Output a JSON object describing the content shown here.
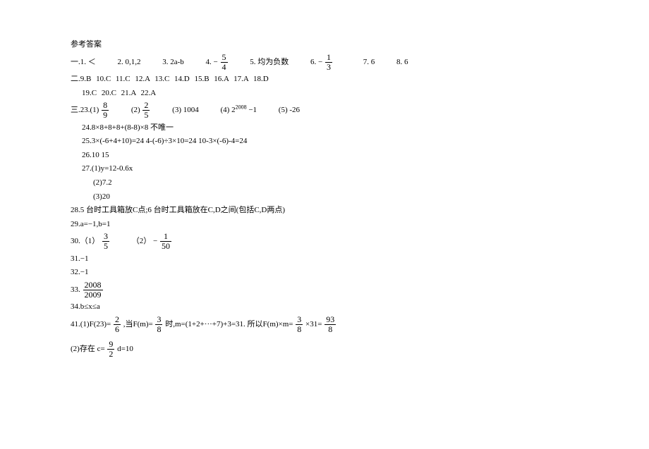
{
  "title": "参考答案",
  "sec1": {
    "prefix": "一.1.",
    "a1": "＜",
    "a2p": "2.",
    "a2": "0,1,2",
    "a3p": "3.",
    "a3": "2a-b",
    "a4p": "4.",
    "a4neg": "−",
    "a4num": "5",
    "a4den": "4",
    "a5p": "5.",
    "a5": "均为负数",
    "a6p": "6.",
    "a6neg": "−",
    "a6num": "1",
    "a6den": "3",
    "a7p": "7.",
    "a7": "6",
    "a8p": "8.",
    "a8": "6"
  },
  "sec2": {
    "l1": "二.9.B    10.C    11.C    12.A    13.C     14.D    15.B     16.A    17.A     18.D",
    "l2": "19.C    20.C    21.A    22.A"
  },
  "sec3": {
    "prefix": "三.23.(1)",
    "f1num": "8",
    "f1den": "9",
    "p2": "(2)",
    "f2num": "2",
    "f2den": "5",
    "p3": "(3)",
    "a3": "1004",
    "p4": "(4)",
    "a4base": "2",
    "a4exp": "2008",
    "a4rest": "−1",
    "p5": "(5)",
    "a5": "-26"
  },
  "a24": "24.8×8+8+8+(8-8)×8    不唯一",
  "a25": "25.3×(-6+4+10)=24    4-(-6)÷3×10=24      10-3×(-6)-4=24",
  "a26": "26.10   15",
  "a27_1": "27.(1)y=12-0.6x",
  "a27_2": "(2)7.2",
  "a27_3": "(3)20",
  "a28": "28.5 台时工具箱放C点;6 台时工具箱放在C,D之间(包括C,D两点)",
  "a29": "29.a=−1,b=1",
  "a30": {
    "prefix": "30.（1）",
    "f1num": "3",
    "f1den": "5",
    "p2": "（2）",
    "neg": "−",
    "f2num": "1",
    "f2den": "50"
  },
  "a31": "31.−1",
  "a32": "32.−1",
  "a33": {
    "prefix": "33.",
    "num": "2008",
    "den": "2009"
  },
  "a34": "34.b≤x≤a",
  "a41": {
    "prefix": "41.(1)F(23)=",
    "f1num": "2",
    "f1den": "6",
    "mid1": ",当F(m)=",
    "f2num": "3",
    "f2den": "8",
    "mid2": "时,m=(1+2+···+7)+3=31. 所以F(m)×m=",
    "f3num": "3",
    "f3den": "8",
    "times": "×31=",
    "f4num": "93",
    "f4den": "8"
  },
  "a41_2": {
    "prefix": "(2)存在 c=",
    "num": "9",
    "den": "2",
    "suffix": "  d=10"
  }
}
